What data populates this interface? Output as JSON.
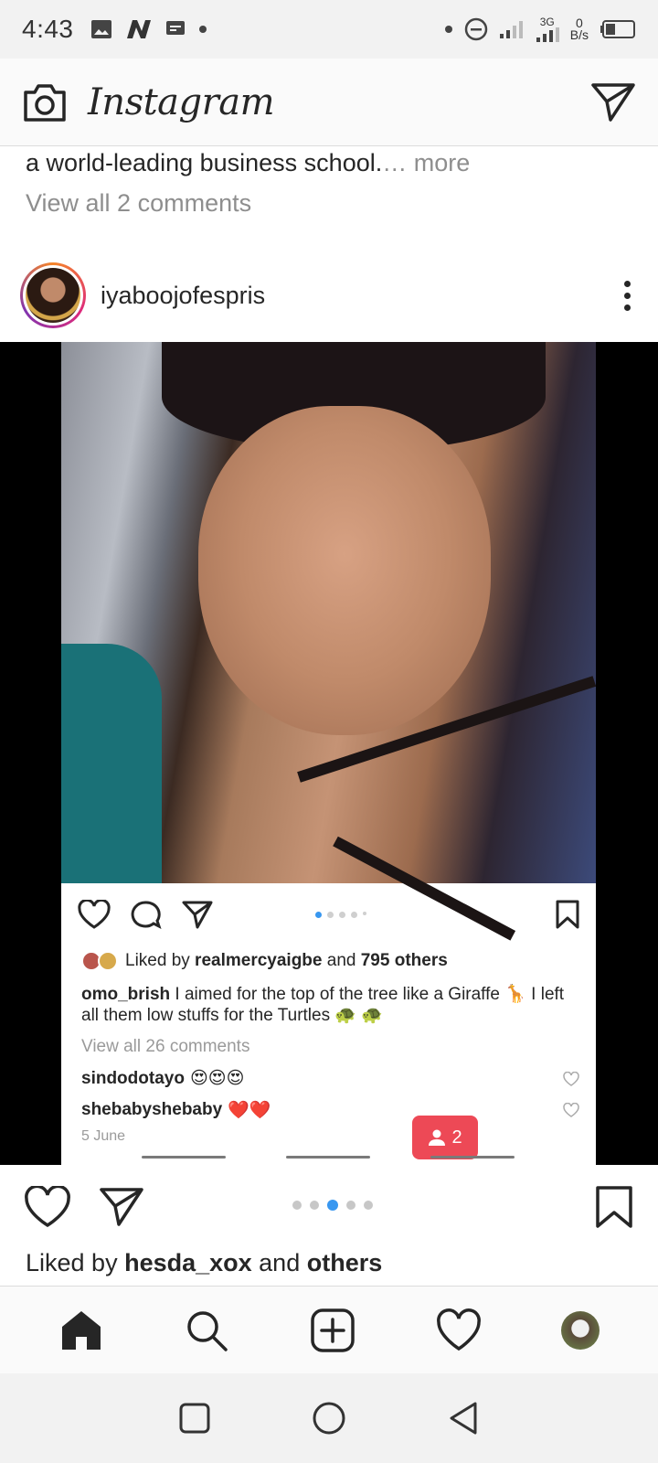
{
  "status_bar": {
    "time": "4:43",
    "network": "3G",
    "speed_value": "0",
    "speed_unit": "B/s"
  },
  "app_bar": {
    "brand": "Instagram",
    "icons": [
      "camera-icon",
      "direct-message-icon"
    ]
  },
  "previous_post": {
    "caption_text": "a world-leading business school.",
    "caption_more": "… more",
    "view_comments": "View all 2 comments"
  },
  "post": {
    "username": "iyaboojofespris",
    "carousel": {
      "total": 5,
      "active_index": 2
    },
    "liked_by_prefix": "Liked by ",
    "liked_by_user": "hesda_xox",
    "liked_by_and": " and ",
    "liked_by_others": "others"
  },
  "embedded_screenshot": {
    "liked_prefix": "Liked by ",
    "liked_user": "realmercyaigbe",
    "liked_and": " and ",
    "liked_count": "795 others",
    "caption_user": "omo_brish",
    "caption_text": " I aimed for the top of the tree like a Giraffe 🦒 I left all them low stuffs for the Turtles 🐢 🐢",
    "view_all_comments": "View all 26 comments",
    "comments": [
      {
        "user": "sindodotayo",
        "text": "😍😍😍"
      },
      {
        "user": "shebabyshebaby",
        "text": "❤️❤️"
      }
    ],
    "date": "5 June",
    "notification_count": "2",
    "carousel": {
      "total": 5,
      "active_index": 0
    }
  },
  "tab_bar": {
    "tabs": [
      "home",
      "search",
      "new-post",
      "activity",
      "profile"
    ],
    "active": "home"
  },
  "system_nav": [
    "recent-apps",
    "home",
    "back"
  ],
  "colors": {
    "accent_blue": "#3897f0",
    "notification_red": "#ed4956",
    "text_primary": "#262626",
    "text_secondary": "#8e8e8e"
  }
}
